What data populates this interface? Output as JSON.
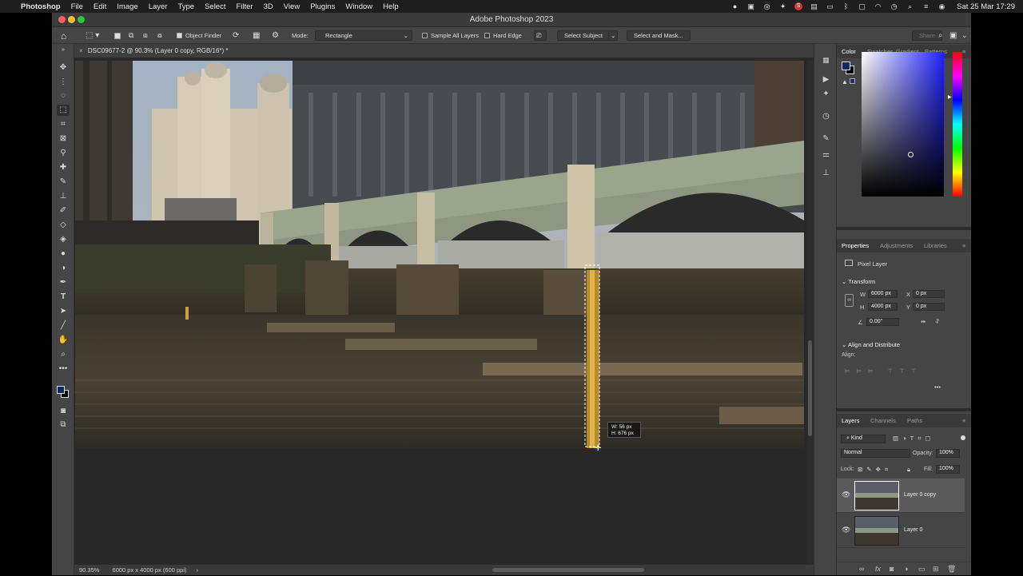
{
  "menubar": {
    "app_name": "Photoshop",
    "items": [
      "File",
      "Edit",
      "Image",
      "Layer",
      "Type",
      "Select",
      "Filter",
      "3D",
      "View",
      "Plugins",
      "Window",
      "Help"
    ],
    "clock": "Sat 25 Mar  17:29"
  },
  "window": {
    "title": "Adobe Photoshop 2023"
  },
  "options_bar": {
    "object_finder": "Object Finder",
    "mode_label": "Mode:",
    "mode_value": "Rectangle",
    "sample_all_layers": "Sample All Layers",
    "hard_edge": "Hard Edge",
    "select_subject": "Select Subject",
    "select_and_mask": "Select and Mask...",
    "share": "Share"
  },
  "document": {
    "tab_title": "DSC09677-2 @ 90.3% (Layer 0 copy, RGB/16*) *",
    "selection_width": "W:   56 px",
    "selection_height": "H: 676 px"
  },
  "status_bar": {
    "zoom": "90.35%",
    "doc_info": "6000 px x 4000 px (600 ppi)",
    "arrow": "›"
  },
  "color_panel": {
    "tabs": [
      "Color",
      "Swatches",
      "Gradient",
      "Patterns"
    ],
    "active_tab": "Color",
    "foreground": "#0f2a5c",
    "background": "#000000"
  },
  "properties_panel": {
    "tabs": [
      "Properties",
      "Adjustments",
      "Libraries"
    ],
    "layer_type": "Pixel Layer",
    "transform_header": "Transform",
    "w_label": "W",
    "w_value": "6000 px",
    "h_label": "H",
    "h_value": "4000 px",
    "x_label": "X",
    "x_value": "0 px",
    "y_label": "Y",
    "y_value": "0 px",
    "angle": "0.00°",
    "align_header": "Align and Distribute",
    "align_label": "Align:",
    "more": "•••"
  },
  "layers_panel": {
    "tabs": [
      "Layers",
      "Channels",
      "Paths"
    ],
    "kind_filter": "Kind",
    "blend_mode": "Normal",
    "opacity_label": "Opacity:",
    "opacity_value": "100%",
    "lock_label": "Lock:",
    "fill_label": "Fill:",
    "fill_value": "100%",
    "layers": [
      {
        "name": "Layer 0 copy",
        "selected": true
      },
      {
        "name": "Layer 0",
        "selected": false
      }
    ],
    "footer_fx": "fx"
  },
  "icons": [
    "apple-icon",
    "home-icon",
    "marquee-icon",
    "move-icon",
    "lasso-icon",
    "crop-icon",
    "eyedropper-icon",
    "brush-icon",
    "stamp-icon",
    "eraser-icon",
    "bucket-icon",
    "dodge-icon",
    "pen-icon",
    "type-icon",
    "path-select-icon",
    "line-icon",
    "hand-icon",
    "zoom-icon",
    "eye-icon",
    "lock-icon",
    "trash-icon"
  ]
}
